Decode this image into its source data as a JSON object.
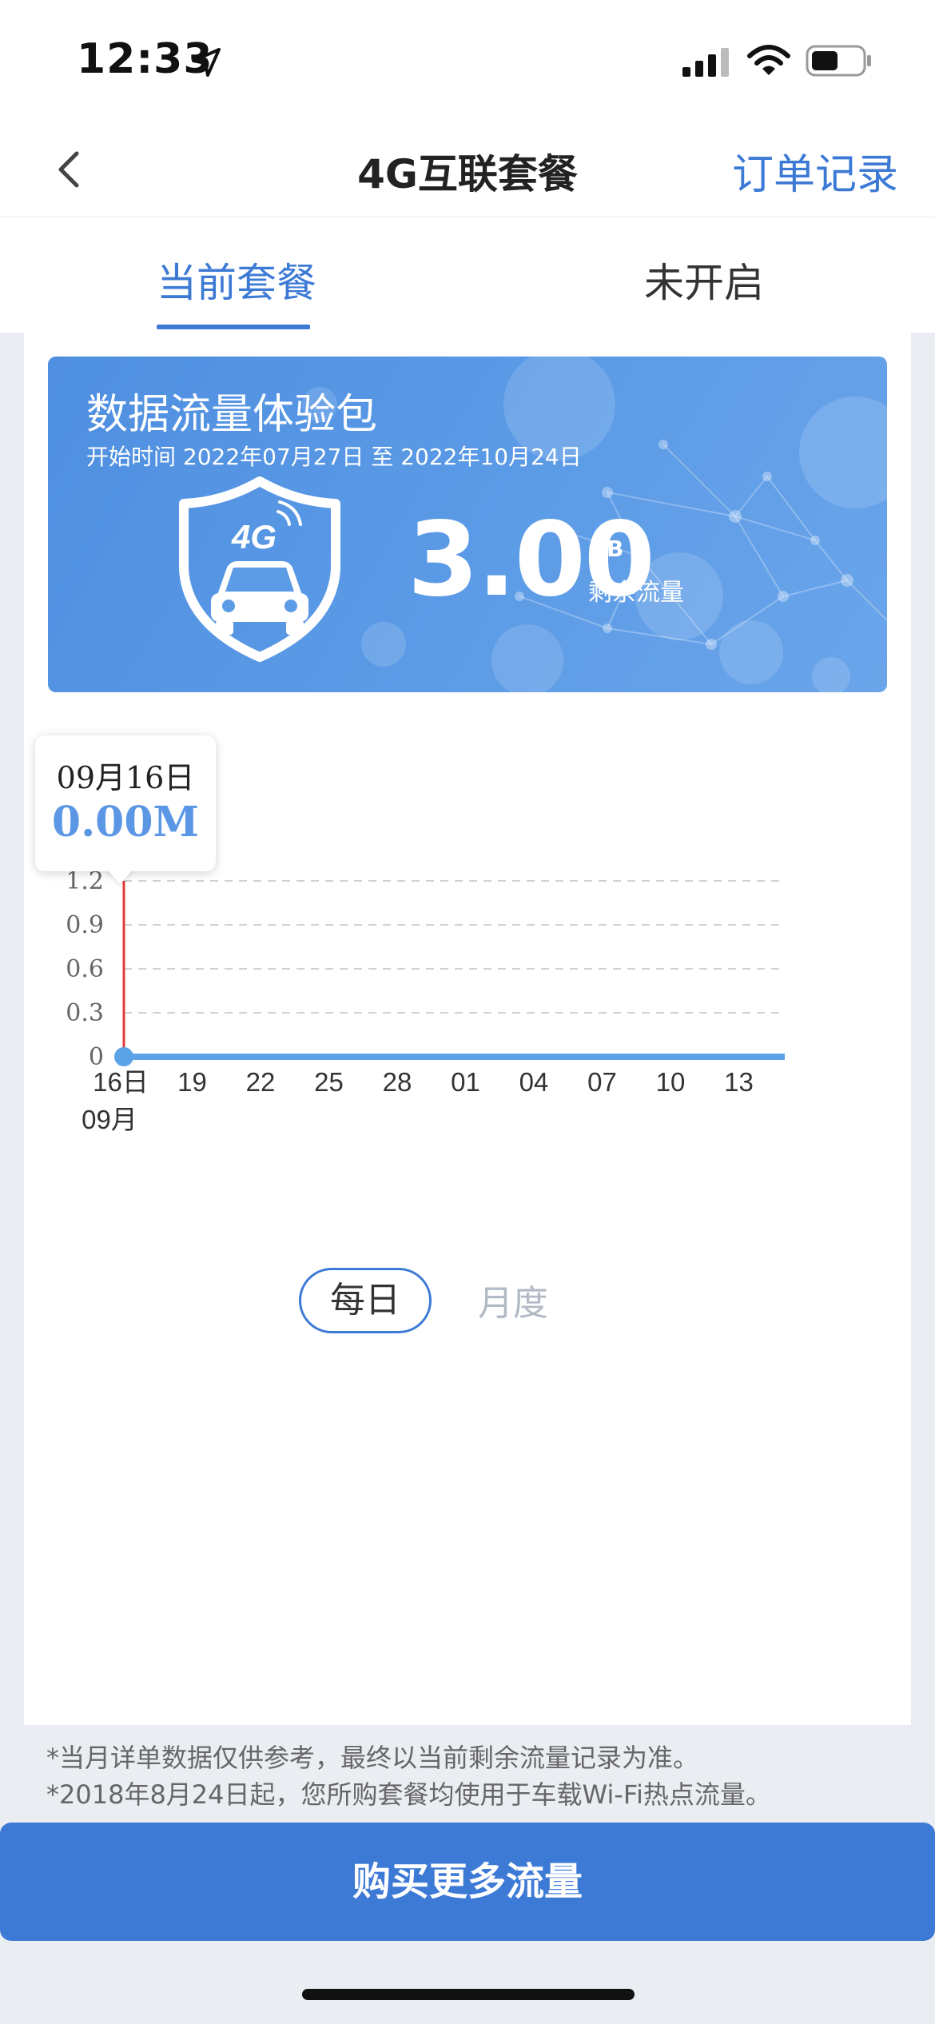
{
  "status_bar": {
    "time": "12:33",
    "icons": [
      "location-arrow-icon",
      "cellular-signal-icon",
      "wifi-icon",
      "battery-icon"
    ]
  },
  "nav": {
    "title": "4G互联套餐",
    "right_action": "订单记录",
    "back_icon": "chevron-left-icon"
  },
  "tabs": [
    {
      "label": "当前套餐",
      "active": true
    },
    {
      "label": "未开启",
      "active": false
    }
  ],
  "package": {
    "name": "数据流量体验包",
    "date_range": "开始时间 2022年07月27日 至 2022年10月24日",
    "remaining_amount": "3.00",
    "remaining_unit": "GB",
    "remaining_label": "剩余流量",
    "icon": "shield-4g-car-icon"
  },
  "tooltip": {
    "date": "09月16日",
    "value": "0.00M"
  },
  "chart_data": {
    "type": "line",
    "x": [
      "16日",
      "19",
      "22",
      "25",
      "28",
      "01",
      "04",
      "07",
      "10",
      "13"
    ],
    "x_sublabel": "09月",
    "y_ticks": [
      "0",
      "0.3",
      "0.6",
      "0.9",
      "1.2"
    ],
    "ylim": [
      0,
      1.2
    ],
    "series": [
      {
        "values": [
          0,
          0,
          0,
          0,
          0,
          0,
          0,
          0,
          0,
          0
        ],
        "color": "#5ba3e6"
      }
    ],
    "grid": true,
    "highlight_index": 0,
    "cursor_color": "#e03a3a"
  },
  "period_toggle": {
    "daily": "每日",
    "monthly": "月度",
    "selected": "daily"
  },
  "notes": [
    "*当月详单数据仅供参考，最终以当前剩余流量记录为准。",
    "*2018年8月24日起，您所购套餐均使用于车载Wi-Fi热点流量。"
  ],
  "buy_button": "购买更多流量",
  "colors": {
    "accent": "#3d7ad6",
    "banner": "#5c9be6",
    "line": "#5ba3e6",
    "cursor": "#e03a3a"
  }
}
